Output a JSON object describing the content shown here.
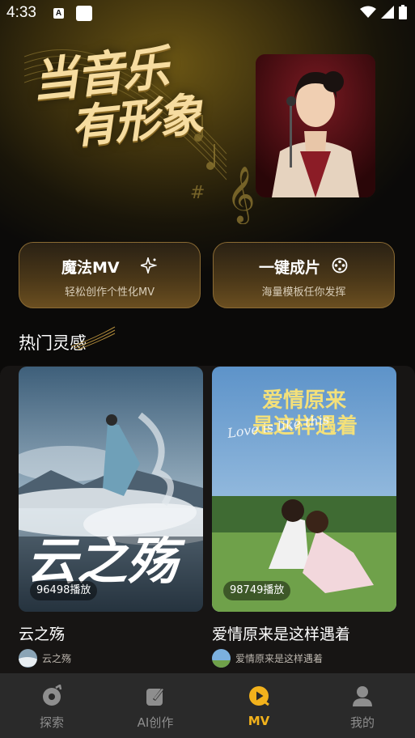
{
  "status_bar": {
    "time": "4:33",
    "notif_a": "A"
  },
  "hero": {
    "title_line1": "当音乐",
    "title_line2": "有形象"
  },
  "actions": [
    {
      "title": "魔法MV",
      "subtitle": "轻松创作个性化MV",
      "icon": "sparkle-icon"
    },
    {
      "title": "一键成片",
      "subtitle": "海量模板任你发挥",
      "icon": "film-reel-icon"
    }
  ],
  "section": {
    "title": "热门灵感"
  },
  "feed": [
    {
      "cover_text": "云之殇",
      "plays": "96498播放",
      "name": "云之殇",
      "author": "云之殇"
    },
    {
      "cover_title_line1": "爱情原来",
      "cover_title_line2": "是这样遇着",
      "cover_script": "Love is like this",
      "plays": "98749播放",
      "name": "爱情原来是这样遇着",
      "author": "爱情原来是这样遇着"
    }
  ],
  "tabs": [
    {
      "label": "探索",
      "icon": "explore-icon",
      "active": false
    },
    {
      "label": "AI创作",
      "icon": "ai-create-icon",
      "active": false
    },
    {
      "label": "MV",
      "icon": "mv-play-icon",
      "active": true
    },
    {
      "label": "我的",
      "icon": "profile-icon",
      "active": false
    }
  ],
  "colors": {
    "accent": "#f2b21c",
    "gold_text": "#f6dca0",
    "tabbar_bg": "#2a2a2a"
  }
}
